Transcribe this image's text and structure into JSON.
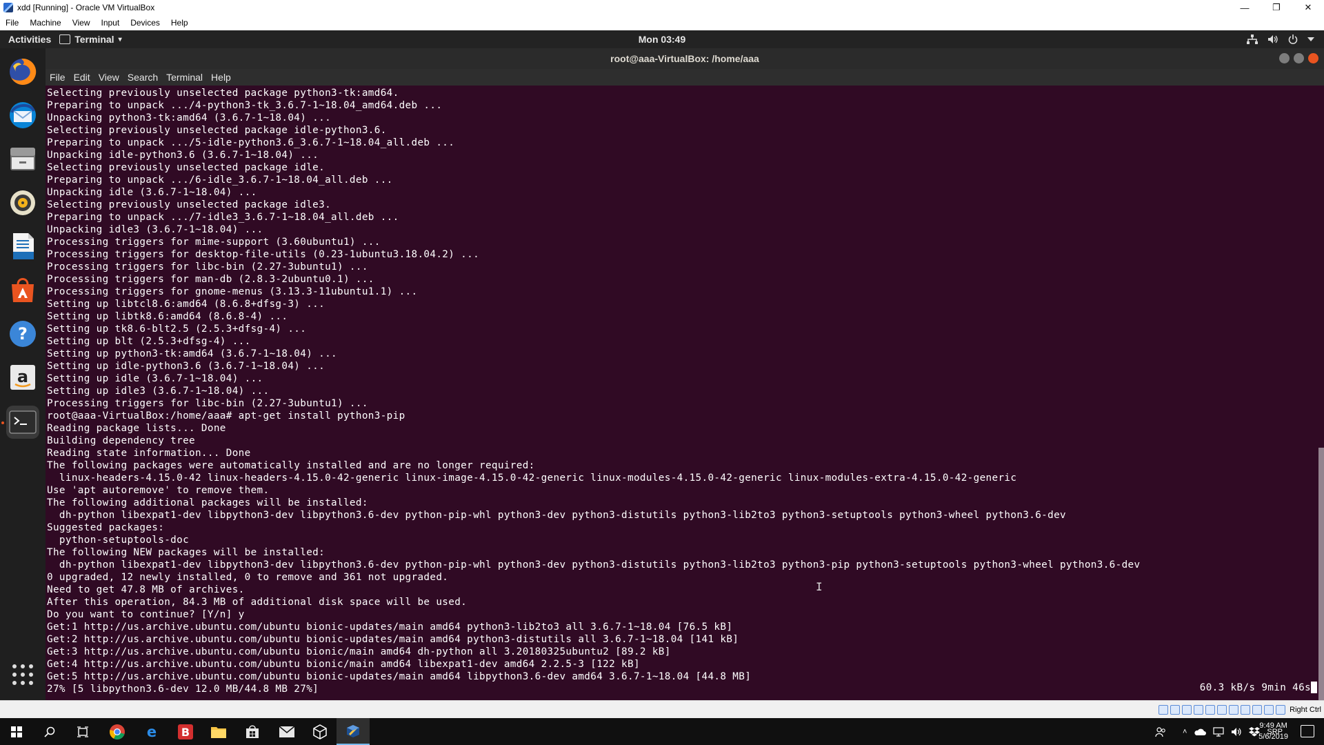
{
  "host_window": {
    "title": "xdd [Running] - Oracle VM VirtualBox",
    "menu": [
      "File",
      "Machine",
      "View",
      "Input",
      "Devices",
      "Help"
    ],
    "controls": {
      "minimize": "—",
      "restore": "❐",
      "close": "✕"
    }
  },
  "gnome_topbar": {
    "activities": "Activities",
    "app_name": "Terminal",
    "caret": "▾",
    "clock": "Mon 03:49",
    "tray_icons": [
      "network-icon",
      "volume-icon",
      "power-icon",
      "chevron-down-icon"
    ]
  },
  "dock": {
    "apps": [
      "firefox",
      "thunderbird",
      "files",
      "rhythmbox",
      "libreoffice-writer",
      "ubuntu-software",
      "help",
      "amazon",
      "terminal"
    ],
    "show_apps_label": "Show Applications"
  },
  "terminal": {
    "title": "root@aaa-VirtualBox: /home/aaa",
    "menu": [
      "File",
      "Edit",
      "View",
      "Search",
      "Terminal",
      "Help"
    ],
    "lines": [
      "Selecting previously unselected package python3-tk:amd64.",
      "Preparing to unpack .../4-python3-tk_3.6.7-1~18.04_amd64.deb ...",
      "Unpacking python3-tk:amd64 (3.6.7-1~18.04) ...",
      "Selecting previously unselected package idle-python3.6.",
      "Preparing to unpack .../5-idle-python3.6_3.6.7-1~18.04_all.deb ...",
      "Unpacking idle-python3.6 (3.6.7-1~18.04) ...",
      "Selecting previously unselected package idle.",
      "Preparing to unpack .../6-idle_3.6.7-1~18.04_all.deb ...",
      "Unpacking idle (3.6.7-1~18.04) ...",
      "Selecting previously unselected package idle3.",
      "Preparing to unpack .../7-idle3_3.6.7-1~18.04_all.deb ...",
      "Unpacking idle3 (3.6.7-1~18.04) ...",
      "Processing triggers for mime-support (3.60ubuntu1) ...",
      "Processing triggers for desktop-file-utils (0.23-1ubuntu3.18.04.2) ...",
      "Processing triggers for libc-bin (2.27-3ubuntu1) ...",
      "Processing triggers for man-db (2.8.3-2ubuntu0.1) ...",
      "Processing triggers for gnome-menus (3.13.3-11ubuntu1.1) ...",
      "Setting up libtcl8.6:amd64 (8.6.8+dfsg-3) ...",
      "Setting up libtk8.6:amd64 (8.6.8-4) ...",
      "Setting up tk8.6-blt2.5 (2.5.3+dfsg-4) ...",
      "Setting up blt (2.5.3+dfsg-4) ...",
      "Setting up python3-tk:amd64 (3.6.7-1~18.04) ...",
      "Setting up idle-python3.6 (3.6.7-1~18.04) ...",
      "Setting up idle (3.6.7-1~18.04) ...",
      "Setting up idle3 (3.6.7-1~18.04) ...",
      "Processing triggers for libc-bin (2.27-3ubuntu1) ...",
      "root@aaa-VirtualBox:/home/aaa# apt-get install python3-pip",
      "Reading package lists... Done",
      "Building dependency tree",
      "Reading state information... Done",
      "The following packages were automatically installed and are no longer required:",
      "  linux-headers-4.15.0-42 linux-headers-4.15.0-42-generic linux-image-4.15.0-42-generic linux-modules-4.15.0-42-generic linux-modules-extra-4.15.0-42-generic",
      "Use 'apt autoremove' to remove them.",
      "The following additional packages will be installed:",
      "  dh-python libexpat1-dev libpython3-dev libpython3.6-dev python-pip-whl python3-dev python3-distutils python3-lib2to3 python3-setuptools python3-wheel python3.6-dev",
      "Suggested packages:",
      "  python-setuptools-doc",
      "The following NEW packages will be installed:",
      "  dh-python libexpat1-dev libpython3-dev libpython3.6-dev python-pip-whl python3-dev python3-distutils python3-lib2to3 python3-pip python3-setuptools python3-wheel python3.6-dev",
      "0 upgraded, 12 newly installed, 0 to remove and 361 not upgraded.",
      "Need to get 47.8 MB of archives.",
      "After this operation, 84.3 MB of additional disk space will be used.",
      "Do you want to continue? [Y/n] y",
      "Get:1 http://us.archive.ubuntu.com/ubuntu bionic-updates/main amd64 python3-lib2to3 all 3.6.7-1~18.04 [76.5 kB]",
      "Get:2 http://us.archive.ubuntu.com/ubuntu bionic-updates/main amd64 python3-distutils all 3.6.7-1~18.04 [141 kB]",
      "Get:3 http://us.archive.ubuntu.com/ubuntu bionic/main amd64 dh-python all 3.20180325ubuntu2 [89.2 kB]",
      "Get:4 http://us.archive.ubuntu.com/ubuntu bionic/main amd64 libexpat1-dev amd64 2.2.5-3 [122 kB]",
      "Get:5 http://us.archive.ubuntu.com/ubuntu bionic-updates/main amd64 libpython3.6-dev amd64 3.6.7-1~18.04 [44.8 MB]",
      "27% [5 libpython3.6-dev 12.0 MB/44.8 MB 27%]"
    ],
    "download_status": "60.3 kB/s 9min 46s"
  },
  "vbox_statusbar": {
    "host_key": "Right Ctrl"
  },
  "win_taskbar": {
    "clock_time": "9:49 AM",
    "clock_date": "5/6/2019",
    "language": "SRP",
    "pinned": [
      "start",
      "search",
      "task-view",
      "chrome",
      "edge",
      "b-app",
      "file-explorer",
      "store",
      "mail",
      "3d-app",
      "virtualbox"
    ]
  },
  "colors": {
    "terminal_bg": "#300a24",
    "terminal_fg": "#ffffff",
    "ubuntu_orange": "#e95420",
    "gnome_bar": "#232323",
    "dock_bg": "#1f1f1f"
  }
}
